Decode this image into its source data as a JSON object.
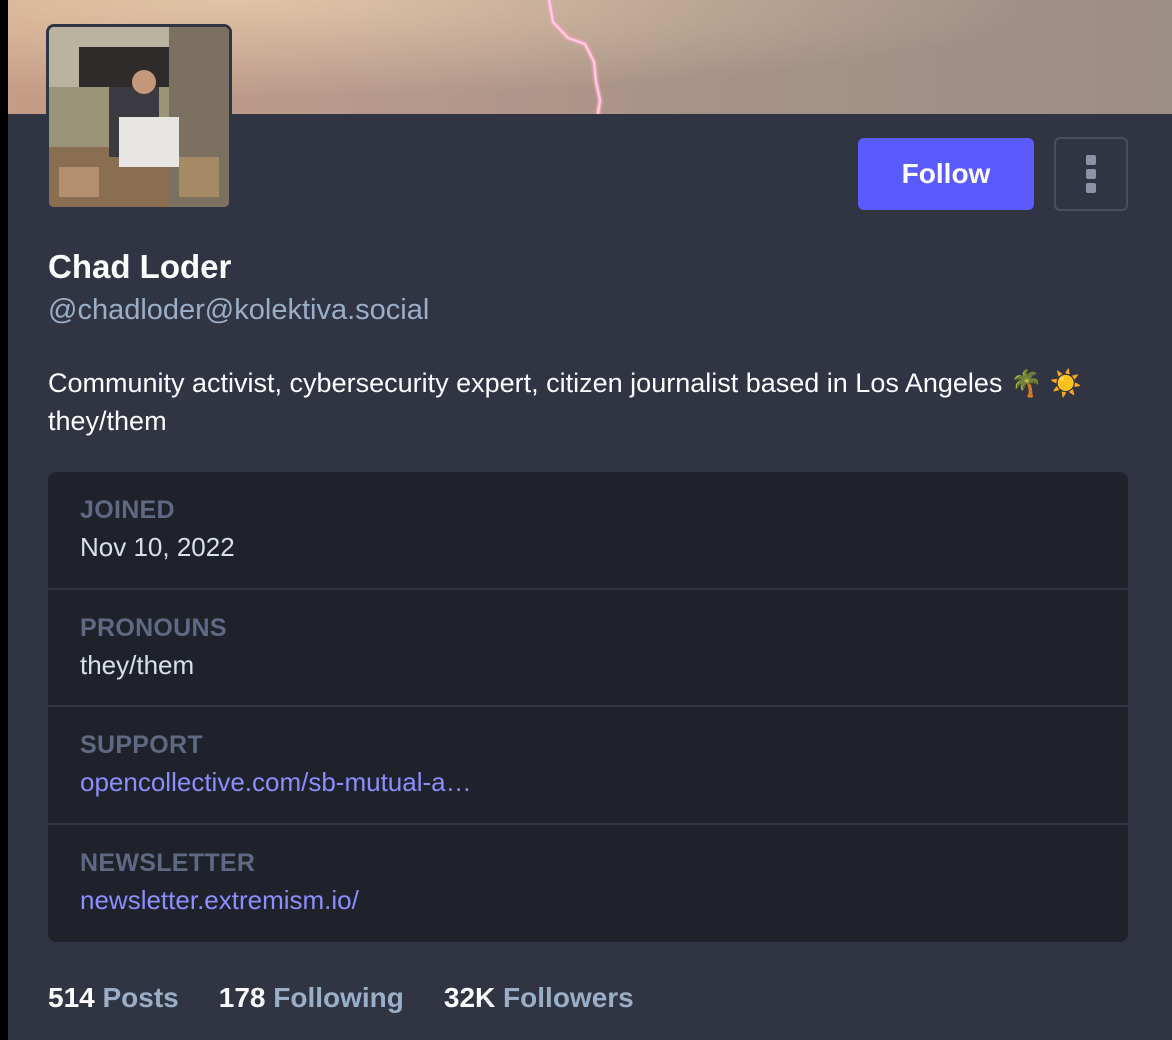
{
  "profile": {
    "display_name": "Chad Loder",
    "handle": "@chadloder@kolektiva.social",
    "bio_line1": "Community activist, cybersecurity expert, citizen journalist based in Los Angeles",
    "bio_emoji1": "🌴",
    "bio_emoji2": "☀️",
    "bio_line2": "they/them"
  },
  "actions": {
    "follow_label": "Follow"
  },
  "fields": [
    {
      "label": "JOINED",
      "value": "Nov 10, 2022"
    },
    {
      "label": "PRONOUNS",
      "value": "they/them"
    },
    {
      "label": "SUPPORT",
      "value": "opencollective.com/sb-mutual-a…"
    },
    {
      "label": "NEWSLETTER",
      "value": "newsletter.extremism.io/"
    }
  ],
  "stats": {
    "posts_count": "514",
    "posts_label": "Posts",
    "following_count": "178",
    "following_label": "Following",
    "followers_count": "32K",
    "followers_label": "Followers"
  },
  "colors": {
    "accent": "#595aff",
    "link": "#8c8dff",
    "secondary_text": "#9baec8",
    "panel_bg": "#313543",
    "fields_bg": "#1f222b"
  }
}
